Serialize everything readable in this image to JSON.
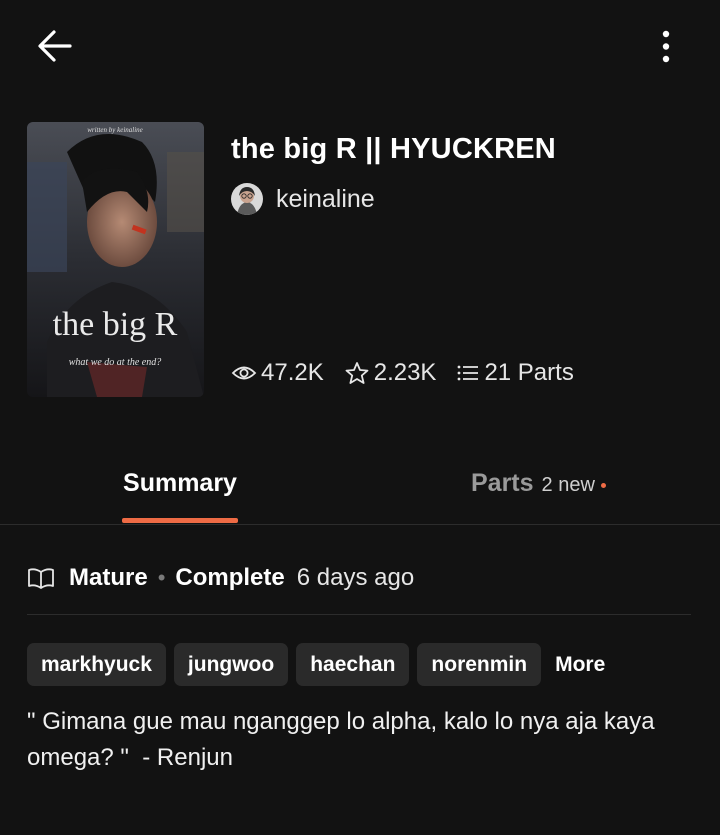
{
  "header": {
    "back_icon": "arrow-left-icon",
    "menu_icon": "more-vertical-icon"
  },
  "story": {
    "title": "the big R || HYUCKREN",
    "author": "keinaline",
    "cover": {
      "top_text": "written by keinaline",
      "big_title": "the big R",
      "subtitle": "what we do at the end?"
    },
    "stats": {
      "reads": "47.2K",
      "votes": "2.23K",
      "parts": "21 Parts"
    }
  },
  "tabs": {
    "summary_label": "Summary",
    "parts_label": "Parts",
    "parts_new": "2 new"
  },
  "meta": {
    "rating": "Mature",
    "separator": "•",
    "status": "Complete",
    "updated": "6 days ago"
  },
  "tags": [
    "markhyuck",
    "jungwoo",
    "haechan",
    "norenmin"
  ],
  "tags_more": "More",
  "description": "\" Gimana gue mau nganggep lo alpha, kalo lo nya aja kaya omega? \"  - Renjun",
  "colors": {
    "background": "#121212",
    "accent": "#ee6b45",
    "tag_bg": "#2a2a2a",
    "divider": "#2c2c2c"
  }
}
